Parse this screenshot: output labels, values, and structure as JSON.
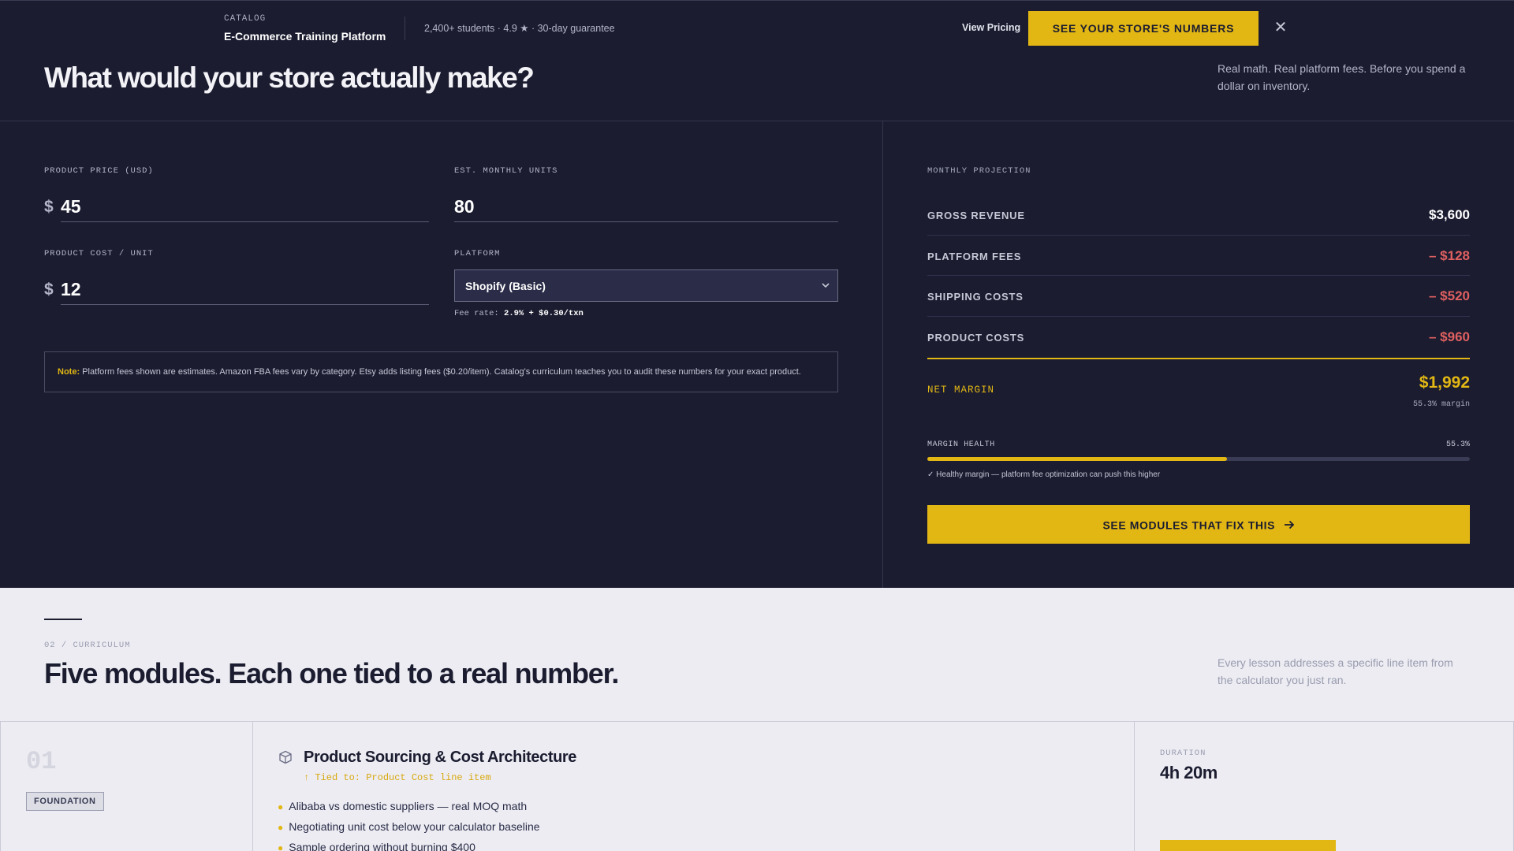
{
  "header": {
    "brand_label": "CATALOG",
    "brand_name": "E-Commerce Training Platform",
    "stats": "2,400+ students · 4.9 ★ · 30-day guarantee",
    "view_pricing": "View Pricing",
    "cta": "SEE YOUR STORE'S NUMBERS",
    "close_icon": "close-icon"
  },
  "hero": {
    "title": "What would your store actually make?",
    "subtitle": "Real math. Real platform fees. Before you spend a dollar on inventory."
  },
  "calculator": {
    "price_label": "PRODUCT PRICE (USD)",
    "currency_symbol": "$",
    "price_value": "45",
    "units_label": "EST. MONTHLY UNITS",
    "units_value": "80",
    "cost_label": "PRODUCT COST / UNIT",
    "cost_value": "12",
    "platform_label": "PLATFORM",
    "platform_value": "Shopify (Basic)",
    "fee_rate_label": "Fee rate:",
    "fee_rate_value": "2.9% + $0.30/txn",
    "note_label": "Note:",
    "note_text": "Platform fees shown are estimates. Amazon FBA fees vary by category. Etsy adds listing fees ($0.20/item). Catalog's curriculum teaches you to audit these numbers for your exact product."
  },
  "projection": {
    "label": "MONTHLY PROJECTION",
    "rows": [
      {
        "label": "GROSS REVENUE",
        "value": "$3,600",
        "negative": false
      },
      {
        "label": "PLATFORM FEES",
        "value": "– $128",
        "negative": true
      },
      {
        "label": "SHIPPING COSTS",
        "value": "– $520",
        "negative": true
      },
      {
        "label": "PRODUCT COSTS",
        "value": "– $960",
        "negative": true
      }
    ],
    "net_label": "NET MARGIN",
    "net_value": "$1,992",
    "net_margin_text": "55.3% margin",
    "health_label": "MARGIN HEALTH",
    "health_pct_text": "55.3%",
    "health_fraction": 0.553,
    "health_note": "✓ Healthy margin — platform fee optimization can push this higher",
    "cta": "SEE MODULES THAT FIX THIS",
    "cta_icon": "arrow-right-icon"
  },
  "curriculum": {
    "section_num": "02 / CURRICULUM",
    "title": "Five modules. Each one tied to a real number.",
    "subtitle": "Every lesson addresses a specific line item from the calculator you just ran.",
    "modules": [
      {
        "num": "01",
        "tag": "FOUNDATION",
        "icon": "cube-icon",
        "title": "Product Sourcing & Cost Architecture",
        "tied": "↑ Tied to: Product Cost line item",
        "bullets": [
          "Alibaba vs domestic suppliers — real MOQ math",
          "Negotiating unit cost below your calculator baseline",
          "Sample ordering without burning $400"
        ],
        "duration_label": "DURATION",
        "duration": "4h 20m"
      }
    ]
  },
  "colors": {
    "background": "#1b1c30",
    "accent": "#e2b714",
    "negative": "#e06060",
    "light_bg": "#ececf2"
  }
}
